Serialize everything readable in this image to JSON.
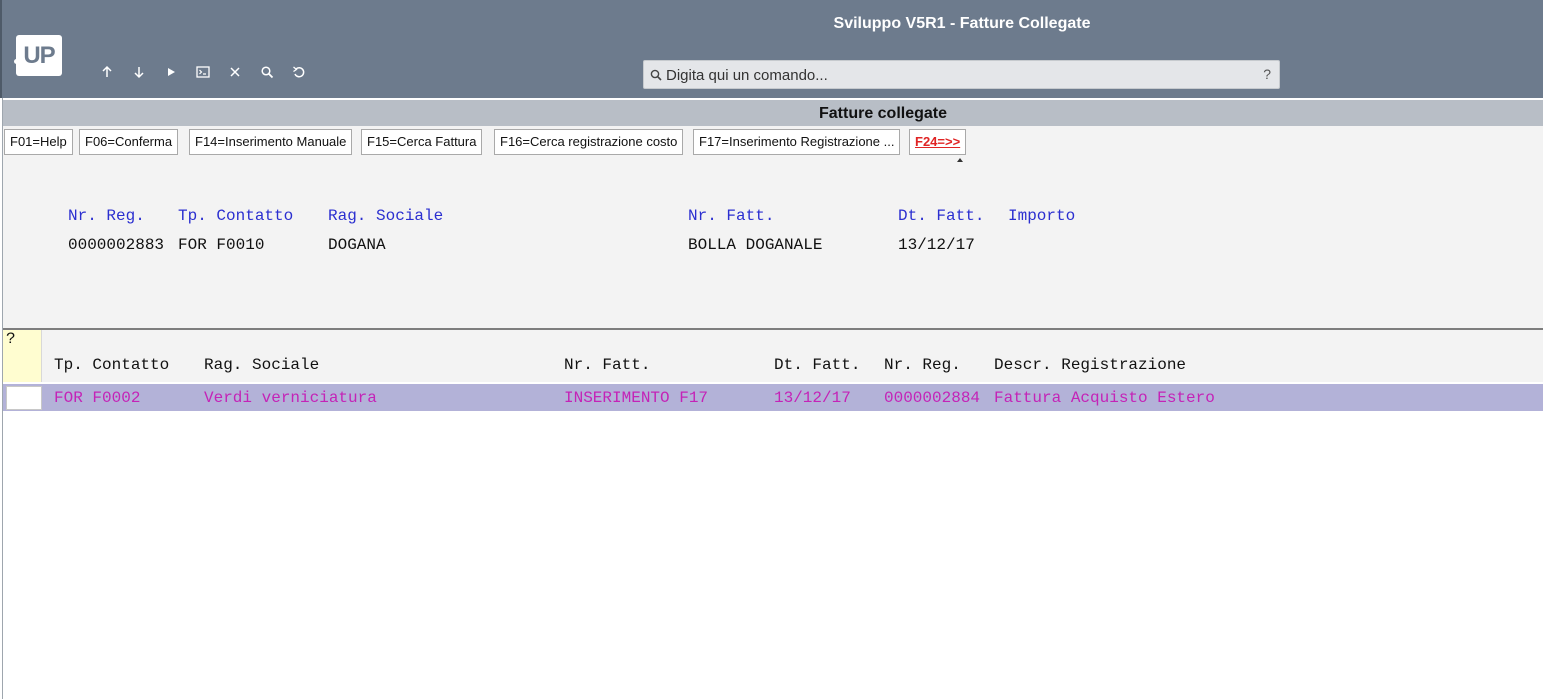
{
  "app": {
    "title": "Sviluppo V5R1 - Fatture Collegate",
    "logo_text": "UP"
  },
  "toolbar": {
    "icons": [
      "arrow-up-icon",
      "arrow-down-icon",
      "play-icon",
      "terminal-icon",
      "close-icon",
      "search-icon",
      "undo-icon"
    ]
  },
  "command": {
    "placeholder": "Digita qui un comando...",
    "help": "?"
  },
  "section": {
    "title": "Fatture collegate"
  },
  "fkeys": [
    "F01=Help",
    "F06=Conferma",
    "F14=Inserimento Manuale",
    "F15=Cerca Fattura",
    "F16=Cerca registrazione costo",
    "F17=Inserimento Registrazione ...",
    "F24=>>"
  ],
  "header": {
    "labels": {
      "nr_reg": "Nr. Reg.",
      "tp_contatto": "Tp. Contatto",
      "rag_sociale": "Rag. Sociale",
      "nr_fatt": "Nr. Fatt.",
      "dt_fatt": "Dt. Fatt.",
      "importo": "Importo"
    },
    "values": {
      "nr_reg": "0000002883",
      "tp_contatto": "FOR F0010",
      "rag_sociale": "DOGANA",
      "nr_fatt": "BOLLA DOGANALE",
      "dt_fatt": "13/12/17",
      "importo": ""
    }
  },
  "grid": {
    "option_header": "?",
    "columns": {
      "tp_contatto": "Tp. Contatto",
      "rag_sociale": "Rag. Sociale",
      "nr_fatt": "Nr. Fatt.",
      "dt_fatt": "Dt. Fatt.",
      "nr_reg": "Nr. Reg.",
      "descr": "Descr. Registrazione"
    },
    "rows": [
      {
        "option": "",
        "tp_contatto": "FOR F0002",
        "rag_sociale": "Verdi verniciatura",
        "nr_fatt": "INSERIMENTO F17",
        "dt_fatt": "13/12/17",
        "nr_reg": "0000002884",
        "descr": "Fattura Acquisto Estero"
      }
    ]
  },
  "colors": {
    "titlebar": "#6d7b8d",
    "label_blue": "#2b2fd0",
    "row_highlight": "#b3b2d8",
    "row_text": "#c423b7",
    "fkey_more": "#e02424"
  }
}
